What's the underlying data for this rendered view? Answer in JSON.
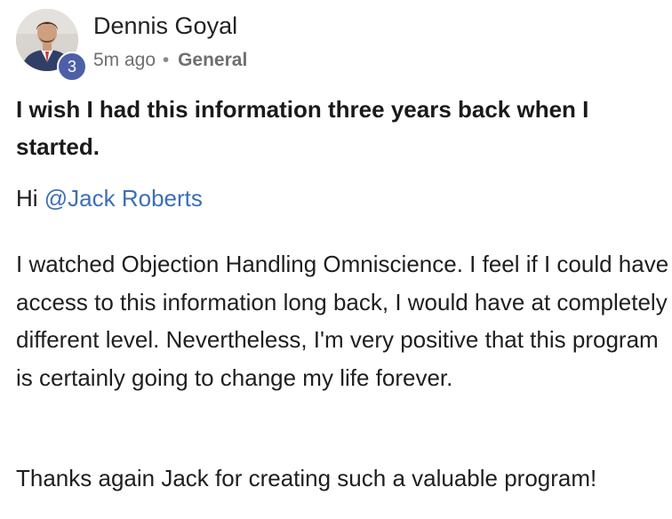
{
  "post": {
    "author": {
      "name": "Dennis Goyal",
      "level": "3"
    },
    "time": "5m ago",
    "separator": "•",
    "category": "General",
    "title": "I wish I had this information three years back when I started.",
    "greeting": {
      "text": "Hi ",
      "mention": "@Jack Roberts"
    },
    "body": "I watched Objection Handling Omniscience. I feel if I could have access to this information long back, I would have at completely different level. Nevertheless, I'm very positive that this program is certainly going to change my life forever.",
    "closing": "Thanks again Jack for creating such a valuable program!"
  },
  "colors": {
    "badge": "#4c5fa8",
    "mention": "#3c6fb4",
    "meta": "#6f6f6f"
  }
}
